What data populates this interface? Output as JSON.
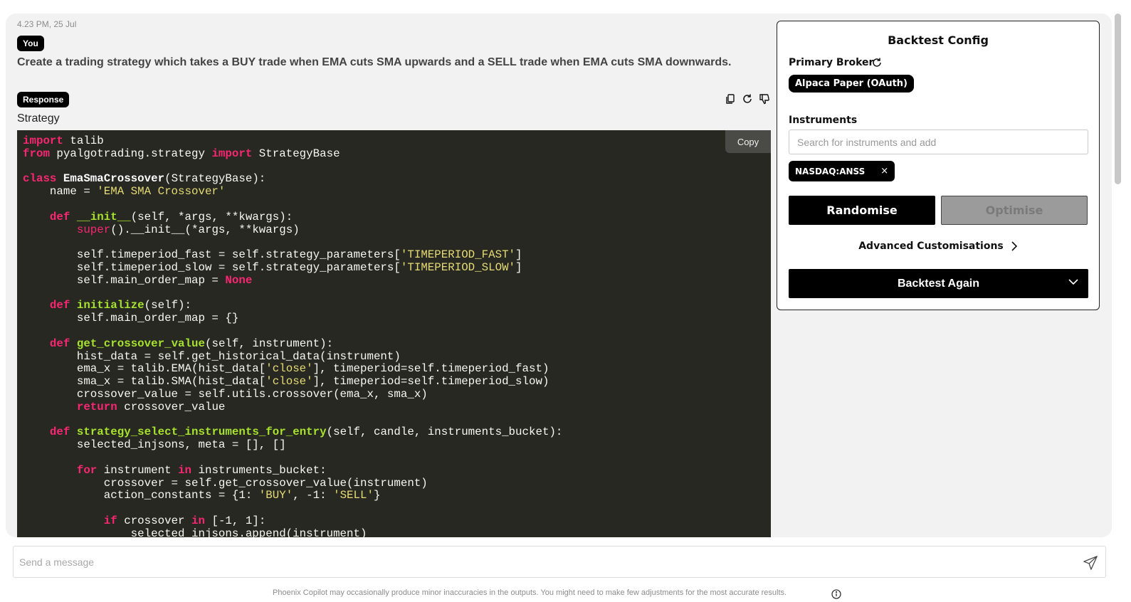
{
  "message": {
    "timestamp": "4.23 PM, 25 Jul",
    "user_badge": "You",
    "prompt": "Create a trading strategy which takes a BUY trade when EMA cuts SMA upwards and a SELL trade when EMA cuts SMA downwards.",
    "response_badge": "Response",
    "section_label": "Strategy",
    "actions": [
      {
        "icon": "copy-icon"
      },
      {
        "icon": "refresh-icon"
      },
      {
        "icon": "thumbs-down-icon"
      }
    ]
  },
  "code": {
    "copy_label": "Copy",
    "language": "python",
    "text": "import talib\nfrom pyalgotrading.strategy import StrategyBase\n\nclass EmaSmaCrossover(StrategyBase):\n    name = 'EMA SMA Crossover'\n\n    def __init__(self, *args, **kwargs):\n        super().__init__(*args, **kwargs)\n\n        self.timeperiod_fast = self.strategy_parameters['TIMEPERIOD_FAST']\n        self.timeperiod_slow = self.strategy_parameters['TIMEPERIOD_SLOW']\n        self.main_order_map = None\n\n    def initialize(self):\n        self.main_order_map = {}\n\n    def get_crossover_value(self, instrument):\n        hist_data = self.get_historical_data(instrument)\n        ema_x = talib.EMA(hist_data['close'], timeperiod=self.timeperiod_fast)\n        sma_x = talib.SMA(hist_data['close'], timeperiod=self.timeperiod_slow)\n        crossover_value = self.utils.crossover(ema_x, sma_x)\n        return crossover_value\n\n    def strategy_select_instruments_for_entry(self, candle, instruments_bucket):\n        selected_injsons, meta = [], []\n\n        for instrument in instruments_bucket:\n            crossover = self.get_crossover_value(instrument)\n            action_constants = {1: 'BUY', -1: 'SELL'}\n\n            if crossover in [-1, 1]:\n                selected_injsons.append(instrument)",
    "keywords": [
      "import",
      "from",
      "class",
      "def",
      "return",
      "for",
      "in",
      "if",
      "None"
    ],
    "builtins": [
      "super"
    ]
  },
  "config": {
    "title": "Backtest Config",
    "broker_label": "Primary Broker",
    "broker_value": "Alpaca Paper (OAuth)",
    "instruments_label": "Instruments",
    "search_placeholder": "Search for instruments and add",
    "instruments": [
      "NASDAQ:ANSS"
    ],
    "chip_remove": "×",
    "randomise_label": "Randomise",
    "optimise_label": "Optimise",
    "advanced_label": "Advanced Customisations",
    "backtest_label": "Backtest Again"
  },
  "composer": {
    "placeholder": "Send a message"
  },
  "footer": {
    "disclaimer": "Phoenix Copilot may occasionally produce minor inaccuracies in the outputs. You might need to make few adjustments for the most accurate results."
  },
  "colors": {
    "code_bg": "#272822",
    "keyword": "#f92672",
    "function": "#a6e22e",
    "string": "#e6db74",
    "text": "#f8f8f2",
    "panel_bg": "#f2f2f2",
    "disabled_btn": "#9b9b9b"
  }
}
